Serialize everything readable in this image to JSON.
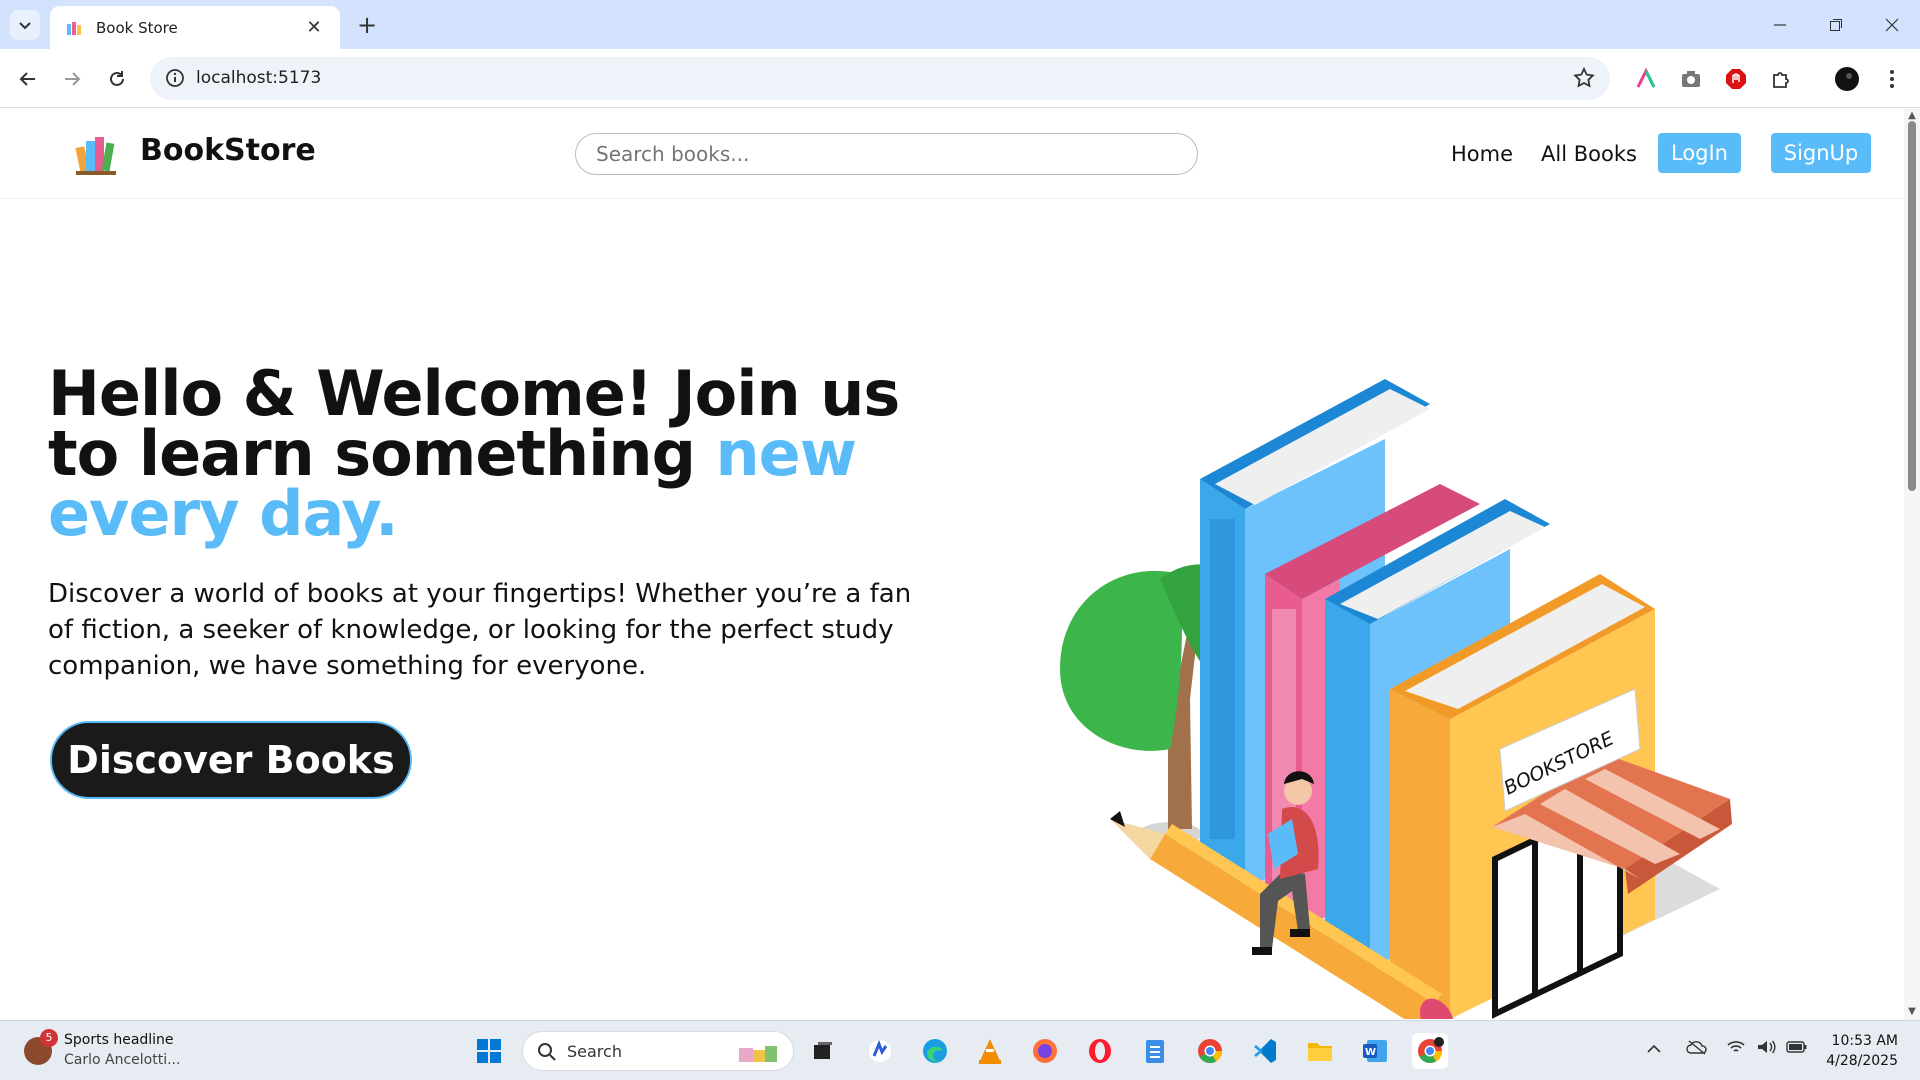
{
  "browser": {
    "tab_title": "Book Store",
    "new_tab": "+",
    "tab_close": "✕",
    "url": "localhost:5173"
  },
  "site": {
    "logo_text": "BookStore",
    "search_placeholder": "Search books...",
    "nav": {
      "home": "Home",
      "all_books": "All Books",
      "login": "LogIn",
      "signup": "SignUp"
    },
    "hero": {
      "title_part1": "Hello & Welcome! Join us to learn something ",
      "title_accent": "new every day.",
      "description": "Discover a world of books at your fingertips! Whether you’re a fan of fiction, a seeker of knowledge, or looking for the perfect study companion, we have something for everyone.",
      "cta": "Discover Books",
      "sign_text": "BOOKSTORE"
    },
    "colors": {
      "accent": "#59bcf8",
      "cta_bg": "#1a1a1a"
    }
  },
  "taskbar": {
    "news_badge": "5",
    "news_title": "Sports headline",
    "news_sub": "Carlo Ancelotti...",
    "search_label": "Search",
    "time": "10:53 AM",
    "date": "4/28/2025"
  }
}
